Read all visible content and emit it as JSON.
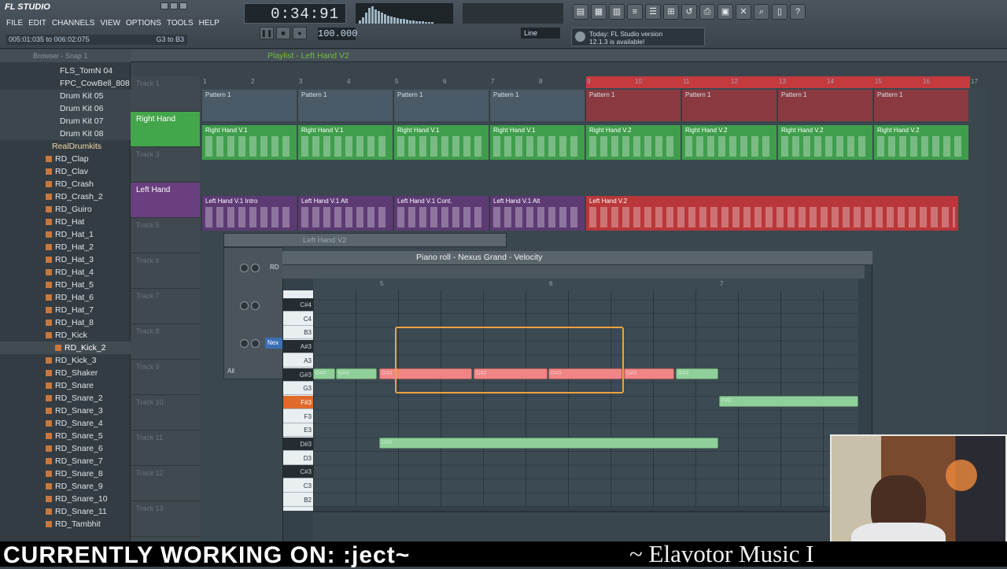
{
  "app": {
    "name": "FL STUDIO"
  },
  "menu": [
    "FILE",
    "EDIT",
    "CHANNELS",
    "VIEW",
    "OPTIONS",
    "TOOLS",
    "HELP"
  ],
  "hint": {
    "left": "005:01:035 to 006:02:075",
    "right": "G3 to B3"
  },
  "transport": {
    "time": "0:34:91",
    "tempo": "100.000",
    "snap": "Line"
  },
  "news": {
    "line1": "Today: FL Studio version",
    "line2": "12.1.3 is available!"
  },
  "browser": {
    "header": "Browser - Snap 1",
    "items": [
      "FLS_TomN 04",
      "FPC_CowBell_808",
      "Drum Kit 05",
      "Drum Kit 06",
      "Drum Kit 07",
      "Drum Kit 08",
      "RealDrumkits",
      "RD_Clap",
      "RD_Clav",
      "RD_Crash",
      "RD_Crash_2",
      "RD_Guiro",
      "RD_Hat",
      "RD_Hat_1",
      "RD_Hat_2",
      "RD_Hat_3",
      "RD_Hat_4",
      "RD_Hat_5",
      "RD_Hat_6",
      "RD_Hat_7",
      "RD_Hat_8",
      "RD_Kick",
      "RD_Kick_2",
      "RD_Kick_3",
      "RD_Shaker",
      "RD_Snare",
      "RD_Snare_2",
      "RD_Snare_3",
      "RD_Snare_4",
      "RD_Snare_5",
      "RD_Snare_6",
      "RD_Snare_7",
      "RD_Snare_8",
      "RD_Snare_9",
      "RD_Snare_10",
      "RD_Snare_11",
      "RD_Tambhit"
    ]
  },
  "playlist": {
    "title": "Playlist - Left Hand V2",
    "ruler": [
      "1",
      "2",
      "3",
      "4",
      "5",
      "6",
      "7",
      "8",
      "9",
      "10",
      "11",
      "12",
      "13",
      "14",
      "15",
      "16",
      "17"
    ],
    "tracks": [
      "Track 1",
      "Right Hand",
      "Track 3",
      "Left Hand",
      "Track 5",
      "Track 6",
      "Track 7",
      "Track 8",
      "Track 9",
      "Track 10",
      "Track 11",
      "Track 12",
      "Track 13"
    ],
    "clips": {
      "pattern": "Pattern 1",
      "rh1": "Right Hand V.1",
      "rh2": "Right Hand V.2",
      "lh": [
        "Left Hand V.1 Intro",
        "Left Hand V.1 Alt",
        "Left Hand V.1 Cont.",
        "Left Hand V.1 Alt",
        "Left Hand V.2"
      ]
    }
  },
  "rack": {
    "title": "Left Hand V2",
    "label1": "RD",
    "label2": "Nex",
    "filter": "All"
  },
  "pianoroll": {
    "title": "Piano roll - Nexus Grand",
    "mode": "Velocity",
    "ruler": [
      "5",
      "6",
      "7"
    ],
    "keys": [
      "C#4",
      "C4",
      "B3",
      "A#3",
      "A3",
      "G#3",
      "G3",
      "F#3",
      "F3",
      "E3",
      "D#3",
      "D3",
      "C#3",
      "C3",
      "B2"
    ],
    "note_labels": {
      "gs": "G#3",
      "fs": "F#3",
      "ds": "D#3"
    }
  },
  "banner": {
    "left": "CURRENTLY WORKING ON: :ject~",
    "right": "~ Elavotor Music I"
  }
}
